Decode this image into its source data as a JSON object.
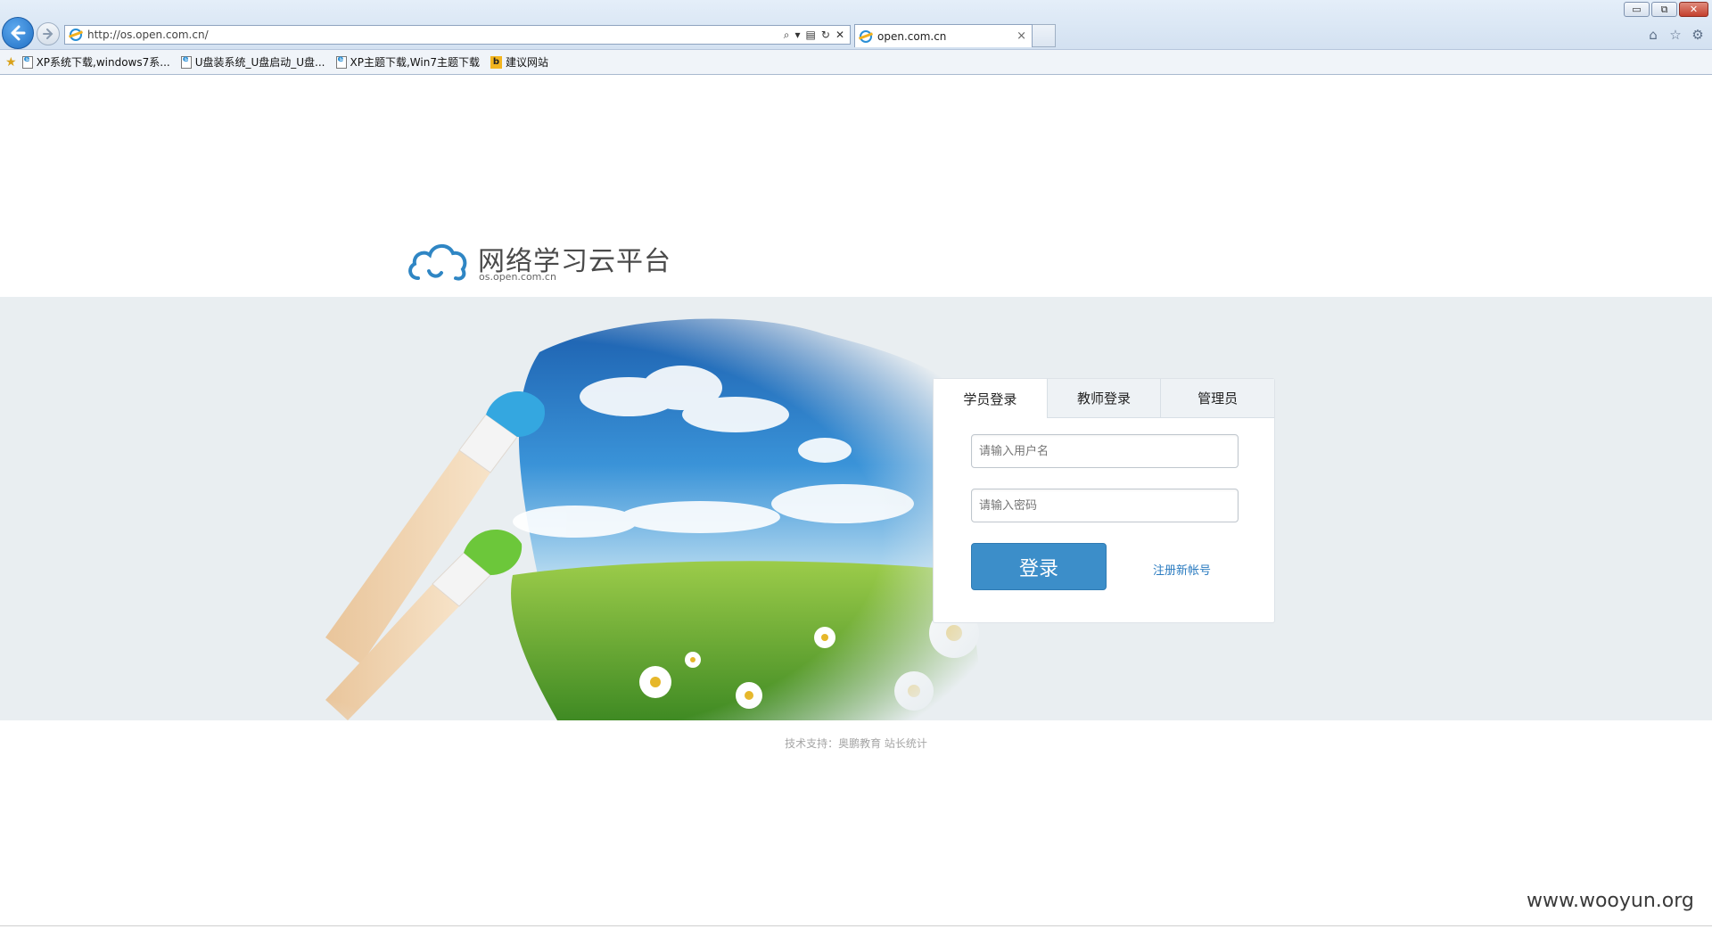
{
  "browser": {
    "address_url": "http://os.open.com.cn/",
    "tab_title": "open.com.cn",
    "tab_close": "×",
    "window_min": "▭",
    "window_max": "⧉",
    "window_close": "✕"
  },
  "favorites": [
    {
      "label": "XP系统下载,windows7系...",
      "icon": "ie-page-icon"
    },
    {
      "label": "U盘装系统_U盘启动_U盘...",
      "icon": "ie-page-icon"
    },
    {
      "label": "XP主题下载,Win7主题下载",
      "icon": "ie-page-icon"
    },
    {
      "label": "建议网站",
      "icon": "bing-icon"
    }
  ],
  "logo": {
    "title": "网络学习云平台",
    "subtitle": "os.open.com.cn"
  },
  "login": {
    "tabs": [
      "学员登录",
      "教师登录",
      "管理员"
    ],
    "active_tab": 0,
    "username_placeholder": "请输入用户名",
    "password_placeholder": "请输入密码",
    "submit_label": "登录",
    "register_link": "注册新帐号"
  },
  "footer": {
    "text": "技术支持：奥鹏教育 站长统计"
  },
  "watermark": "www.wooyun.org",
  "colors": {
    "accent": "#3c8ec9",
    "band": "#e9eef1",
    "link": "#2a7bc0"
  }
}
